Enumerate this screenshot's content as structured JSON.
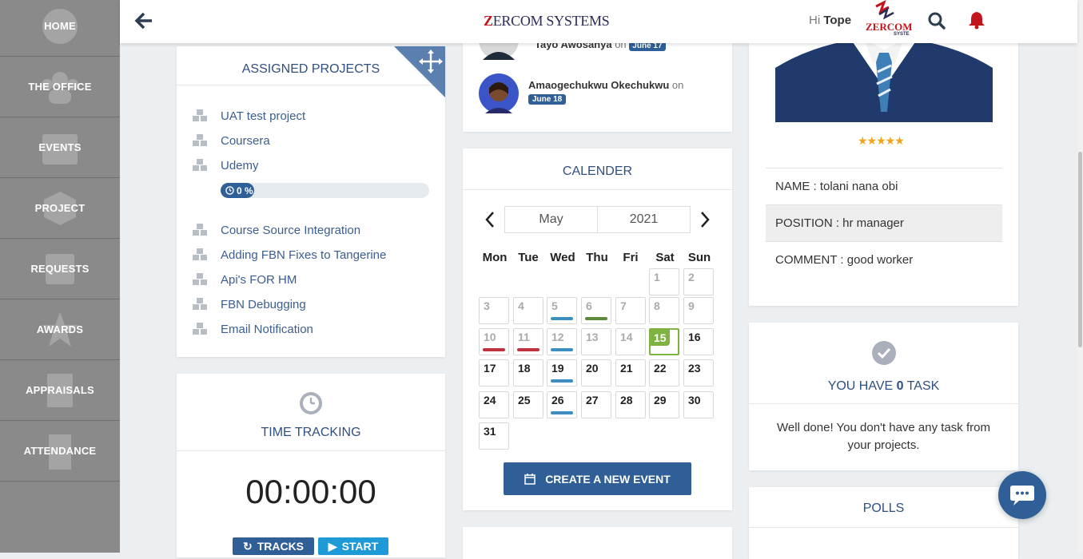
{
  "sidebar": {
    "items": [
      {
        "label": "HOME"
      },
      {
        "label": "THE OFFICE"
      },
      {
        "label": "EVENTS"
      },
      {
        "label": "PROJECT"
      },
      {
        "label": "REQUESTS"
      },
      {
        "label": "AWARDS"
      },
      {
        "label": "APPRAISALS"
      },
      {
        "label": "ATTENDANCE"
      }
    ]
  },
  "topbar": {
    "brand_first": "Z",
    "brand_rest": "ERCOM SYSTEMS",
    "greeting": "Hi",
    "user_name": "Tope",
    "logo_text": "ZERCOM",
    "logo_sub": "SYSTE"
  },
  "projects": {
    "title": "ASSIGNED PROJECTS",
    "items": [
      {
        "name": "UAT test project"
      },
      {
        "name": "Coursera"
      },
      {
        "name": "Udemy"
      },
      {
        "name": "Course Source Integration"
      },
      {
        "name": "Adding FBN Fixes to Tangerine"
      },
      {
        "name": "Api's FOR HM"
      },
      {
        "name": "FBN Debugging"
      },
      {
        "name": "Email Notification"
      }
    ],
    "progress_label": "0 %",
    "progress_value": 0
  },
  "time_tracking": {
    "title": "TIME TRACKING",
    "time": "00:00:00",
    "tracks_label": "TRACKS",
    "start_label": "START"
  },
  "birthdays": {
    "on_word": "on",
    "people": [
      {
        "name": "Tayo Awosanya",
        "date": "June 17"
      },
      {
        "name": "Amaogechukwu Okechukwu",
        "date": "June 18"
      }
    ]
  },
  "calendar": {
    "title": "CALENDER",
    "month": "May",
    "year": "2021",
    "daynames": [
      "Mon",
      "Tue",
      "Wed",
      "Thu",
      "Fri",
      "Sat",
      "Sun"
    ],
    "days": [
      "1",
      "2",
      "3",
      "4",
      "5",
      "6",
      "7",
      "8",
      "9",
      "10",
      "11",
      "12",
      "13",
      "14",
      "15",
      "16",
      "17",
      "18",
      "19",
      "20",
      "21",
      "22",
      "23",
      "24",
      "25",
      "26",
      "27",
      "28",
      "29",
      "30",
      "31"
    ],
    "today": "15",
    "create_label": "CREATE A NEW EVENT",
    "colors": {
      "blue": "#3d8fc1",
      "green": "#5b8a3a",
      "red": "#c0323f",
      "today": "#7fb240"
    }
  },
  "profile": {
    "rating": "★★★★★",
    "name": "NAME : tolani nana obi",
    "position": "POSITION : hr manager",
    "comment": "COMMENT : good worker"
  },
  "tasks": {
    "prefix": "YOU HAVE",
    "count": "0",
    "suffix": "TASK",
    "message": "Well done! You don't have any task from your projects."
  },
  "polls": {
    "title": "POLLS"
  },
  "colors": {
    "primary": "#2f5f96",
    "sidebar": "#8a8a8a",
    "bell": "#c2141b"
  }
}
